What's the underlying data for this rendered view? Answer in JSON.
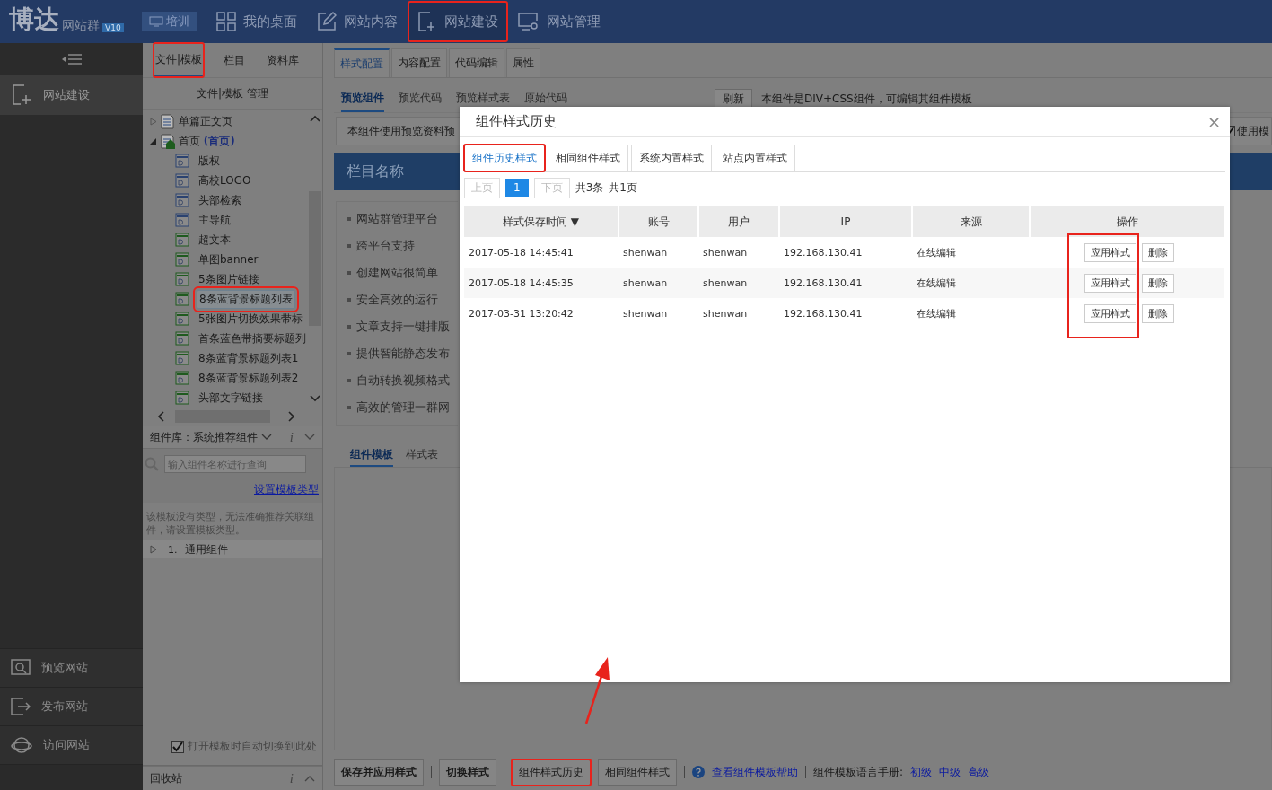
{
  "topbar": {
    "logo": "博达",
    "product": "网站群",
    "version": "V10",
    "training": "培训",
    "nav": [
      {
        "label": "我的桌面",
        "selected": false,
        "highlighted": false
      },
      {
        "label": "网站内容",
        "selected": false,
        "highlighted": false
      },
      {
        "label": "网站建设",
        "selected": true,
        "highlighted": true
      },
      {
        "label": "网站管理",
        "selected": false,
        "highlighted": false
      }
    ]
  },
  "sidebar": {
    "items": [
      {
        "label": "网站建设",
        "selected": true
      }
    ],
    "bottom_items": [
      {
        "label": "预览网站"
      },
      {
        "label": "发布网站"
      },
      {
        "label": "访问网站"
      }
    ]
  },
  "tree_panel": {
    "tabs": [
      {
        "label": "文件|模板",
        "selected": true,
        "highlighted": true
      },
      {
        "label": "栏目",
        "selected": false,
        "highlighted": false
      },
      {
        "label": "资料库",
        "selected": false,
        "highlighted": false
      }
    ],
    "heading": "文件|模板 管理",
    "tree": [
      {
        "label": "单篇正文页",
        "expanded": false
      },
      {
        "label": "首页",
        "tag": "(首页)",
        "expanded": true,
        "children": [
          {
            "label": "版权",
            "kind": "blue",
            "selected": false,
            "highlighted": false
          },
          {
            "label": "高校LOGO",
            "kind": "blue",
            "selected": false,
            "highlighted": false
          },
          {
            "label": "头部检索",
            "kind": "blue",
            "selected": false,
            "highlighted": false
          },
          {
            "label": "主导航",
            "kind": "blue",
            "selected": false,
            "highlighted": false
          },
          {
            "label": "超文本",
            "kind": "green",
            "selected": false,
            "highlighted": false
          },
          {
            "label": "单图banner",
            "kind": "green",
            "selected": false,
            "highlighted": false
          },
          {
            "label": "5条图片链接",
            "kind": "green",
            "selected": false,
            "highlighted": false
          },
          {
            "label": "8条蓝背景标题列表",
            "kind": "green",
            "selected": true,
            "highlighted": true
          },
          {
            "label": "5张图片切换效果带标",
            "kind": "green",
            "selected": false,
            "highlighted": false
          },
          {
            "label": "首条蓝色带摘要标题列",
            "kind": "green",
            "selected": false,
            "highlighted": false
          },
          {
            "label": "8条蓝背景标题列表1",
            "kind": "green",
            "selected": false,
            "highlighted": false
          },
          {
            "label": "8条蓝背景标题列表2",
            "kind": "green",
            "selected": false,
            "highlighted": false
          },
          {
            "label": "头部文字链接",
            "kind": "green",
            "selected": false,
            "highlighted": false
          }
        ]
      }
    ],
    "library": {
      "title": "组件库：系统推荐组件",
      "info": "i",
      "search": {
        "placeholder": "输入组件名称进行查询"
      },
      "link": "设置模板类型",
      "message": "该模板没有类型，无法准确推荐关联组件，请设置模板类型。",
      "groups": [
        {
          "number": "1.",
          "label": "通用组件",
          "expanded": false
        }
      ]
    },
    "auto_switch": {
      "label": "打开模板时自动切换到此处",
      "checked": true
    },
    "recycle": {
      "label": "回收站",
      "info": "i"
    }
  },
  "main": {
    "tabs": [
      {
        "label": "样式配置",
        "selected": true
      },
      {
        "label": "内容配置",
        "selected": false
      },
      {
        "label": "代码编辑",
        "selected": false
      },
      {
        "label": "属性",
        "selected": false
      }
    ],
    "subtabs": [
      {
        "label": "预览组件",
        "selected": true
      },
      {
        "label": "预览代码",
        "selected": false
      },
      {
        "label": "预览样式表",
        "selected": false
      },
      {
        "label": "原始代码",
        "selected": false
      }
    ],
    "refresh": "刷新",
    "component_note": "本组件是DIV+CSS组件，可编辑其组件模板",
    "notice": "本组件使用预览资料预",
    "use_template": {
      "label": "使用模",
      "checked": true
    },
    "preview": {
      "heading": "栏目名称",
      "items": [
        "网站群管理平台",
        "跨平台支持",
        "创建网站很简单",
        "安全高效的运行",
        "文章支持一键排版",
        "提供智能静态发布",
        "自动转换视频格式",
        "高效的管理一群网"
      ]
    },
    "bottom_tabs": [
      {
        "label": "组件模板",
        "selected": true
      },
      {
        "label": "样式表",
        "selected": false
      }
    ],
    "toolbar": [
      {
        "label": "保存并应用样式",
        "kind": "bold",
        "highlighted": false
      },
      {
        "label": "切换样式",
        "kind": "bold",
        "highlighted": false
      },
      {
        "label": "组件样式历史",
        "kind": "plain",
        "highlighted": true
      },
      {
        "label": "相同组件样式",
        "kind": "plain",
        "highlighted": false
      }
    ],
    "help": "查看组件模板帮助",
    "manual_label": "组件模板语言手册:",
    "manual_links": [
      "初级",
      "中级",
      "高级"
    ]
  },
  "modal": {
    "title": "组件样式历史",
    "close": "×",
    "tabs": [
      {
        "label": "组件历史样式",
        "selected": true,
        "highlighted": true
      },
      {
        "label": "相同组件样式",
        "selected": false,
        "highlighted": false
      },
      {
        "label": "系统内置样式",
        "selected": false,
        "highlighted": false
      },
      {
        "label": "站点内置样式",
        "selected": false,
        "highlighted": false
      }
    ],
    "pager": {
      "prev": {
        "label": "上页",
        "disabled": true
      },
      "pages": [
        {
          "label": "1",
          "selected": true
        }
      ],
      "next": {
        "label": "下页",
        "disabled": true
      },
      "total": "共3条",
      "pages_total": "共1页"
    },
    "table": {
      "columns": [
        "样式保存时间 ▼",
        "账号",
        "用户",
        "IP",
        "来源",
        "操作"
      ],
      "rows": [
        {
          "time": "2017-05-18 14:45:41",
          "account": "shenwan",
          "user": "shenwan",
          "ip": "192.168.130.41",
          "source": "在线编辑",
          "actions": [
            "应用样式",
            "删除"
          ]
        },
        {
          "time": "2017-05-18 14:45:35",
          "account": "shenwan",
          "user": "shenwan",
          "ip": "192.168.130.41",
          "source": "在线编辑",
          "actions": [
            "应用样式",
            "删除"
          ]
        },
        {
          "time": "2017-03-31 13:20:42",
          "account": "shenwan",
          "user": "shenwan",
          "ip": "192.168.130.41",
          "source": "在线编辑",
          "actions": [
            "应用样式",
            "删除"
          ]
        }
      ],
      "apply_highlighted": true
    }
  },
  "annotation_arrow": true
}
